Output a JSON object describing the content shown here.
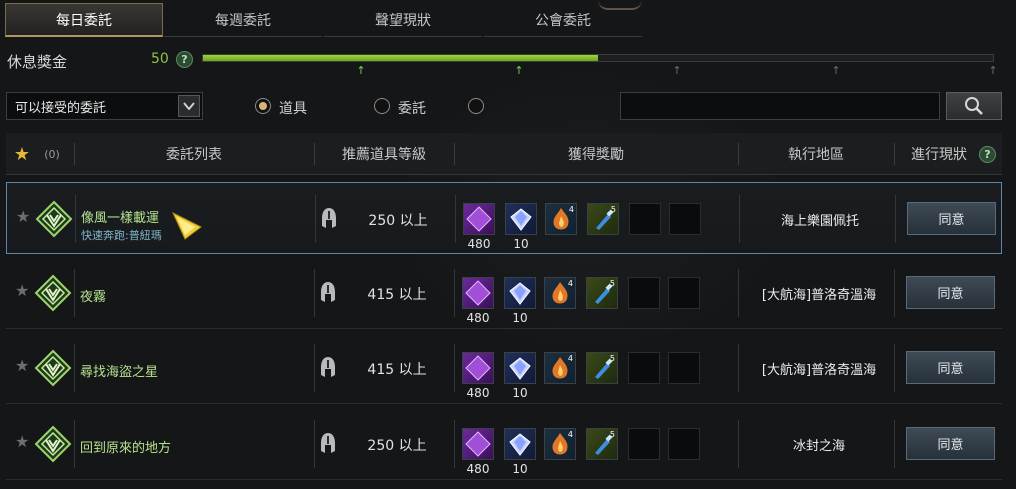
{
  "tabs": [
    {
      "label": "每日委託"
    },
    {
      "label": "每週委託"
    },
    {
      "label": "聲望現狀"
    },
    {
      "label": "公會委託"
    }
  ],
  "rest_bonus": {
    "label": "休息獎金",
    "value": "50",
    "help": "?",
    "progress": 0.5
  },
  "filter": {
    "select_value": "可以接受的委託",
    "radio_options": [
      {
        "label": "道具",
        "checked": true
      },
      {
        "label": "委託",
        "checked": false
      },
      {
        "label": "",
        "checked": false
      }
    ],
    "search_placeholder": ""
  },
  "header": {
    "fav_count": "(0)",
    "col_quest": "委託列表",
    "col_level": "推薦道具等級",
    "col_reward": "獲得獎勵",
    "col_location": "執行地區",
    "col_status": "進行現狀",
    "help": "?"
  },
  "reward_icons": [
    "opyt-crystal-icon",
    "diamond-gem-icon",
    "flame-stone-icon",
    "blue-potion-icon"
  ],
  "colors": {
    "accent_green": "#8ec63f",
    "selected_border": "#5f86a8",
    "tab_active_border": "#b09660"
  },
  "quests": [
    {
      "name": "像風一樣載運",
      "sub": "快速奔跑:普紐瑪",
      "level": "250 以上",
      "rewards": [
        "480",
        "10",
        "4",
        "5"
      ],
      "location": "海上樂園佩托",
      "button": "同意"
    },
    {
      "name": "夜霧",
      "sub": "",
      "level": "415 以上",
      "rewards": [
        "480",
        "10",
        "4",
        "5"
      ],
      "location": "[大航海]普洛奇溫海",
      "button": "同意"
    },
    {
      "name": "尋找海盜之星",
      "sub": "",
      "level": "415 以上",
      "rewards": [
        "480",
        "10",
        "4",
        "5"
      ],
      "location": "[大航海]普洛奇溫海",
      "button": "同意"
    },
    {
      "name": "回到原來的地方",
      "sub": "",
      "level": "250 以上",
      "rewards": [
        "480",
        "10",
        "4",
        "5"
      ],
      "location": "冰封之海",
      "button": "同意"
    }
  ]
}
